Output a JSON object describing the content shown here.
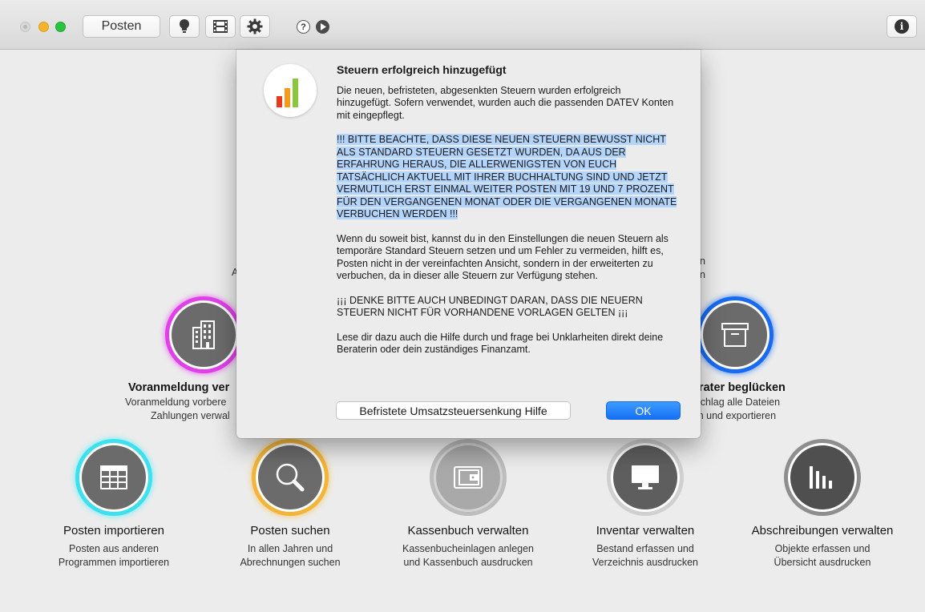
{
  "toolbar": {
    "posten_label": "Posten",
    "help_label": "?",
    "info_label": "i"
  },
  "colors": {
    "accent_blue": "#1670f5",
    "ring_magenta": "#e040e8",
    "ring_blue": "#1a6af0",
    "ring_cyan": "#3fe0ee",
    "ring_orange": "#f2b53a",
    "highlight": "#b3d4fc"
  },
  "tiles_top": {
    "left_title": "Voranmeldung ver",
    "left_sub1": "Voranmeldung vorbere",
    "left_sub2": "Zahlungen verwal",
    "left_frag": "A",
    "right_title": "berater beglücken",
    "right_sub1": "n Schlag alle Dateien",
    "right_sub2": "eln und exportieren",
    "right_frag1": "en",
    "right_frag2": "en"
  },
  "tiles_bottom": [
    {
      "title": "Posten importieren",
      "sub1": "Posten aus anderen",
      "sub2": "Programmen importieren",
      "icon": "table-icon"
    },
    {
      "title": "Posten suchen",
      "sub1": "In allen Jahren und",
      "sub2": "Abrechnungen suchen",
      "icon": "search-icon"
    },
    {
      "title": "Kassenbuch verwalten",
      "sub1": "Kassenbucheinlagen anlegen",
      "sub2": "und Kassenbuch ausdrucken",
      "icon": "wallet-icon"
    },
    {
      "title": "Inventar verwalten",
      "sub1": "Bestand erfassen und",
      "sub2": "Verzeichnis ausdrucken",
      "icon": "monitor-icon"
    },
    {
      "title": "Abschreibungen verwalten",
      "sub1": "Objekte erfassen und",
      "sub2": "Übersicht ausdrucken",
      "icon": "bar-chart-icon"
    }
  ],
  "dialog": {
    "title": "Steuern erfolgreich hinzugefügt",
    "p1": "Die neuen, befristeten, abgesenkten Steuern wurden erfolgreich hinzugefügt. Sofern verwendet, wurden auch die passenden DATEV Konten mit eingepflegt.",
    "p2": "!!! BITTE BEACHTE, DASS DIESE NEUEN STEUERN BEWUSST NICHT ALS STANDARD STEUERN GESETZT WURDEN, DA AUS DER ERFAHRUNG HERAUS, DIE ALLERWENIGSTEN VON EUCH TATSÄCHLICH AKTUELL MIT IHRER BUCHHALTUNG SIND UND JETZT VERMUTLICH ERST EINMAL WEITER POSTEN MIT 19 UND 7 PROZENT FÜR DEN VERGANGENEN MONAT ODER DIE VERGANGENEN MONATE VERBUCHEN WERDEN !!!",
    "p3": "Wenn du soweit bist, kannst du in den Einstellungen die neuen Steuern als temporäre Standard Steuern setzen und um Fehler zu vermeiden, hilft es, Posten nicht in der vereinfachten Ansicht, sondern in der erweiterten zu verbuchen, da in dieser alle Steuern zur Verfügung stehen.",
    "p4": "¡¡¡ DENKE BITTE AUCH UNBEDINGT DARAN, DASS DIE NEUERN STEUERN NICHT FÜR VORHANDENE VORLAGEN GELTEN ¡¡¡",
    "p5": "Lese dir dazu auch die Hilfe durch und frage bei Unklarheiten direkt deine Beraterin oder dein zuständiges Finanzamt.",
    "help_button": "Befristete Umsatzsteuersenkung Hilfe",
    "ok_button": "OK"
  }
}
